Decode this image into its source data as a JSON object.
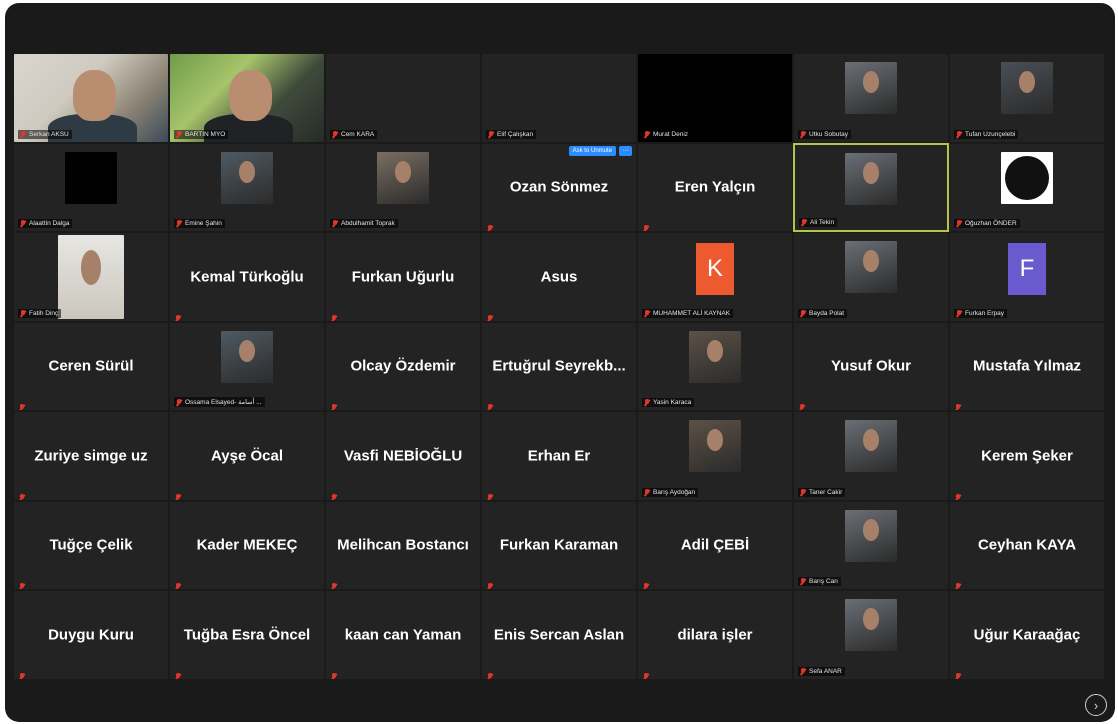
{
  "colors": {
    "window_bg": "#1a1a1a",
    "tile_bg": "#232323",
    "active_border": "#b7c44a",
    "mute": "#e0362b",
    "accent": "#2d8cff"
  },
  "tiles": [
    {
      "label": "Serkan AKSU",
      "video": "full-warm"
    },
    {
      "label": "BARTIN MYO",
      "video": "full-green"
    },
    {
      "label": "Cem KARA"
    },
    {
      "label": "Elif Çalışkan",
      "muted": true
    },
    {
      "label": "Murat Deniz",
      "video": "black-block"
    },
    {
      "label": "Utku Sobutay",
      "video": "photo"
    },
    {
      "label": "Tufan Uzunçelebi",
      "video": "photo"
    },
    {
      "label": "Alaattin Dalga",
      "video": "black-square"
    },
    {
      "label": "Emine Şahin",
      "video": "photo"
    },
    {
      "label": "Abdulhamit Toprak",
      "video": "photo"
    },
    {
      "big": "Ozan Sönmez",
      "unmute": "Ask to Unmute",
      "more": "···"
    },
    {
      "big": "Eren Yalçın"
    },
    {
      "label": "Ali Tekin",
      "video": "photo",
      "active": true
    },
    {
      "label": "Oğuzhan ÖNDER",
      "video": "group-icon"
    },
    {
      "label": "Fatih Dinç",
      "video": "photo-tall"
    },
    {
      "big": "Kemal Türkoğlu"
    },
    {
      "big": "Furkan Uğurlu"
    },
    {
      "big": "Asus"
    },
    {
      "label": "MUHAMMET ALİ KAYNAK",
      "letter": "K",
      "letter_color": "#ee5a2f"
    },
    {
      "label": "Bayda Polat",
      "video": "photo"
    },
    {
      "label": "Furkan Erpay",
      "letter": "F",
      "letter_color": "#6a5acd"
    },
    {
      "big": "Ceren Sürül"
    },
    {
      "label": "Ossama Elsayed- أسامة ...",
      "video": "photo"
    },
    {
      "big": "Olcay Özdemir"
    },
    {
      "big": "Ertuğrul  Seyrekb..."
    },
    {
      "label": "Yasin Karaca",
      "video": "photo"
    },
    {
      "big": "Yusuf Okur"
    },
    {
      "big": "Mustafa Yılmaz"
    },
    {
      "big": "Zuriye simge uz"
    },
    {
      "big": "Ayşe Öcal"
    },
    {
      "big": "Vasfi NEBİOĞLU"
    },
    {
      "big": "Erhan Er"
    },
    {
      "label": "Barış Aydoğan",
      "video": "photo"
    },
    {
      "label": "Taner Cakir",
      "video": "photo"
    },
    {
      "big": "Kerem Şeker"
    },
    {
      "big": "Tuğçe Çelik"
    },
    {
      "big": "Kader MEKEÇ"
    },
    {
      "big": "Melihcan Bostancı"
    },
    {
      "big": "Furkan Karaman"
    },
    {
      "big": "Adil ÇEBİ"
    },
    {
      "label": "Barış Can",
      "video": "photo"
    },
    {
      "big": "Ceyhan KAYA"
    },
    {
      "big": "Duygu Kuru"
    },
    {
      "big": "Tuğba Esra Öncel"
    },
    {
      "big": "kaan can Yaman"
    },
    {
      "big": "Enis Sercan Aslan"
    },
    {
      "big": "dilara işler"
    },
    {
      "label": "Sefa ANAR",
      "video": "photo"
    },
    {
      "big": "Uğur Karaağaç"
    }
  ],
  "nav": {
    "next_icon": "›"
  }
}
